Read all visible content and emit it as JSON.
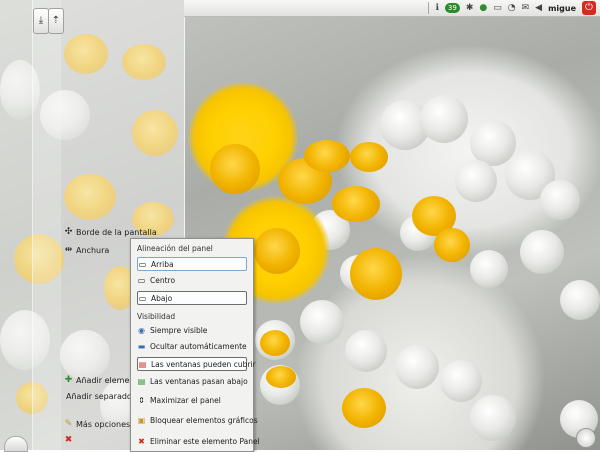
{
  "topbar": {
    "badge": "39",
    "user": "migue"
  },
  "panel": {
    "items": {
      "edge": "Borde de la pantalla",
      "width": "Anchura",
      "add_widgets": "Añadir elementos",
      "add_separator": "Añadir separador",
      "more_options": "Más opciones"
    }
  },
  "menu": {
    "alignment_title": "Alineación del panel",
    "align_top": "Arriba",
    "align_center": "Centro",
    "align_bottom": "Abajo",
    "visibility_title": "Visibilidad",
    "always_visible": "Siempre visible",
    "auto_hide": "Ocultar automáticamente",
    "windows_can_cover": "Las ventanas pueden cubrir",
    "windows_go_below": "Las ventanas pasan abajo",
    "maximize": "Maximizar el panel",
    "lock_widgets": "Bloquear elementos gráficos",
    "remove_panel": "Eliminar este elemento Panel"
  },
  "colors": {
    "accent": "#7fa6c9",
    "danger": "#d0281f",
    "flower_yellow": "#ffd000"
  }
}
